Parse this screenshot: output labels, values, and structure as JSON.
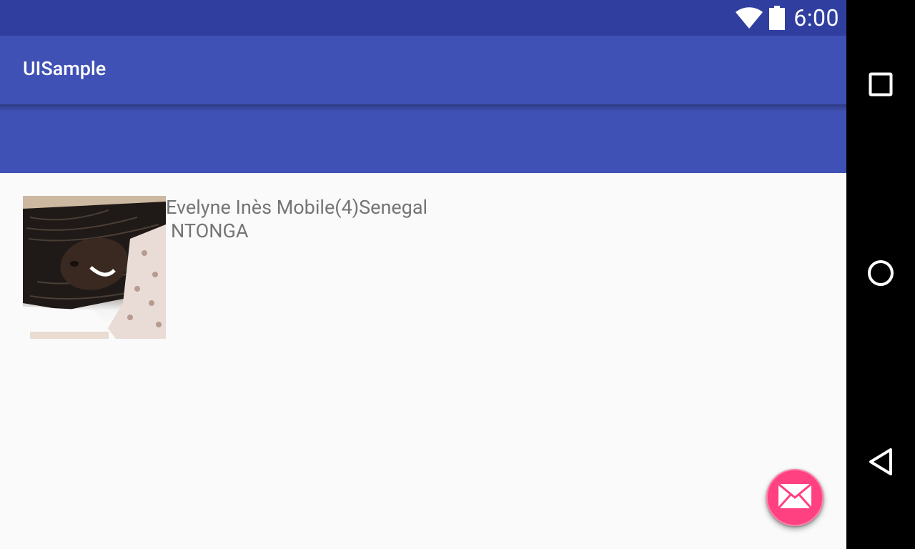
{
  "status_bar": {
    "time": "6:00",
    "wifi_icon": "wifi-icon",
    "battery_icon": "battery-icon"
  },
  "app_bar": {
    "title": "UISample"
  },
  "list": {
    "items": [
      {
        "photo_icon": "profile-photo",
        "name_line1": "Evelyne Inès Mobile(4)Senegal",
        "name_line2": "NTONGA"
      }
    ]
  },
  "fab": {
    "icon": "mail-icon"
  },
  "nav_bar": {
    "recents_icon": "square-icon",
    "home_icon": "circle-icon",
    "back_icon": "triangle-back-icon"
  },
  "colors": {
    "primary_dark": "#303f9f",
    "primary": "#3f51b5",
    "accent": "#ff4081",
    "text_secondary": "#757575"
  }
}
